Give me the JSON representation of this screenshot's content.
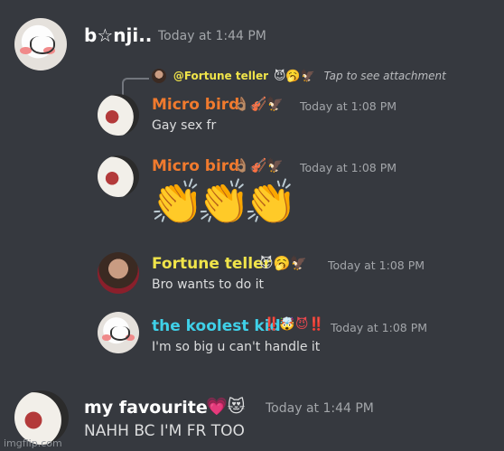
{
  "messages": [
    {
      "author": "b☆nji..",
      "time": "Today at 1:44 PM",
      "author_color": "#ffffff"
    },
    {
      "reply": {
        "name": "@Fortune teller",
        "emojis": "😈🥱🦅",
        "attachment": "Tap to see attachment"
      }
    },
    {
      "author": "Micro bird",
      "emojis": "👌🏽🎻🦅",
      "time": "Today at 1:08 PM",
      "text": "Gay sex fr",
      "author_color": "#f07a2e"
    },
    {
      "author": "Micro bird",
      "emojis": "👌🏽🎻🦅",
      "time": "Today at 1:08 PM",
      "text": "👏👏👏",
      "author_color": "#f07a2e"
    },
    {
      "author": "Fortune teller",
      "emojis": "😈🥱🦅",
      "time": "Today at 1:08 PM",
      "text": "Bro wants to do it",
      "author_color": "#f0e44a"
    },
    {
      "author": "the koolest kid",
      "emojis": "‼️🤯😈‼️",
      "time": "Today at 1:08 PM",
      "text": "I'm so big u can't handle it",
      "author_color": "#3fd0e8"
    },
    {
      "author": "my favourite",
      "emojis": "💗😻",
      "time": "Today at 1:44 PM",
      "text": "NAHH BC I'M FR TOO",
      "author_color": "#ffffff"
    }
  ],
  "watermark": "imgflip.com"
}
